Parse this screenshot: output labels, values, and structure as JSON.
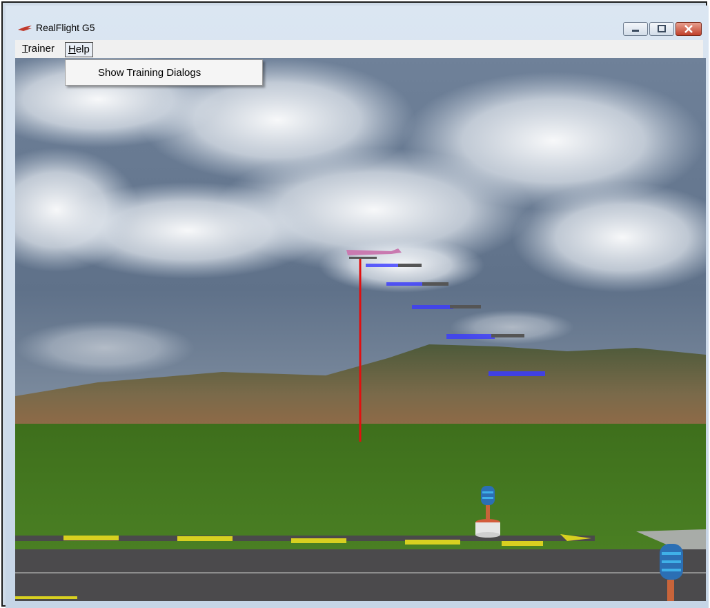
{
  "window": {
    "title": "RealFlight G5"
  },
  "menu": {
    "items": [
      {
        "label": "Trainer",
        "accel": "T",
        "rest": "rainer"
      },
      {
        "label": "Help",
        "accel": "H",
        "rest": "elp"
      }
    ],
    "open_dropdown": {
      "items": [
        "Show Training Dialogs"
      ]
    }
  },
  "scene": {
    "description_icons": [
      "airplane-icon",
      "wind-sock-icon",
      "runway-marker-icon"
    ],
    "colors": {
      "sky": "#5d7088",
      "grass": "#4a7a22",
      "trail": "#3a3aff",
      "pole": "#e01010"
    }
  }
}
